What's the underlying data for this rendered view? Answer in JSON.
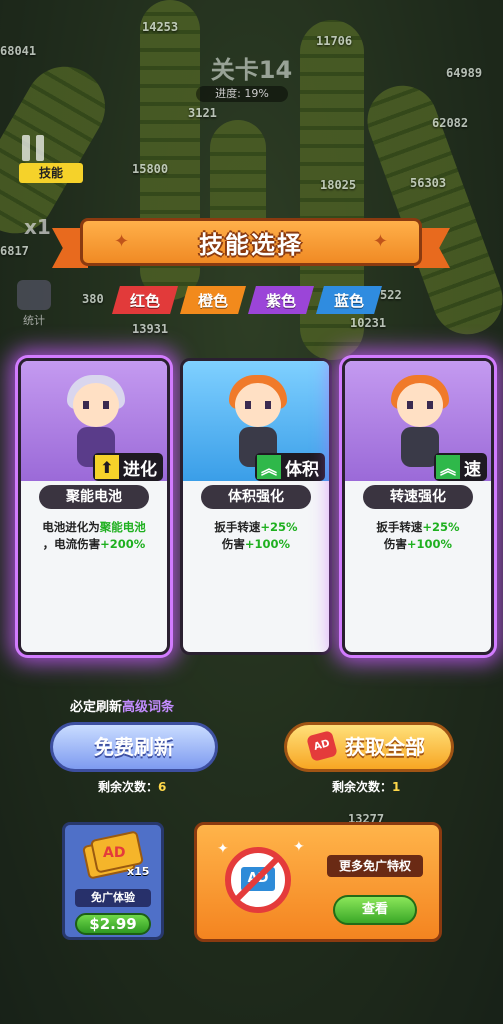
{
  "background": {
    "stage_title": "关卡14",
    "progress_text": "进度: 19%",
    "skill_tag": "技能",
    "speed_label": "x1",
    "stats_label": "统计",
    "numbers": [
      "68041",
      "14253",
      "11706",
      "64989",
      "62082",
      "15800",
      "18025",
      "56303",
      "6817",
      "3121",
      "13931",
      "10231",
      "13277",
      "380",
      "522"
    ]
  },
  "header": {
    "title": "技能选择"
  },
  "color_filters": [
    {
      "label": "红色",
      "color": "#e23a3a"
    },
    {
      "label": "橙色",
      "color": "#f28a1c"
    },
    {
      "label": "紫色",
      "color": "#9b45d8"
    },
    {
      "label": "蓝色",
      "color": "#2f8ce0"
    }
  ],
  "cards": [
    {
      "name": "聚能电池",
      "badge": "进化",
      "badge_icon": "arrow-up-icon",
      "desc_line1_pre": "电池进化为",
      "desc_line1_hl": "聚能电池",
      "desc_line2_pre": "，电流伤害",
      "desc_line2_hl": "+200%",
      "theme": "#c79cf2"
    },
    {
      "name": "体积强化",
      "badge": "体积",
      "badge_icon": "double-chevron-up-icon",
      "desc_line1_pre": "扳手转速",
      "desc_line1_hl": "+25%",
      "desc_line2_pre": "伤害",
      "desc_line2_hl": "+100%",
      "theme": "#5bb7ff"
    },
    {
      "name": "转速强化",
      "badge": "速",
      "badge_icon": "double-chevron-up-icon",
      "desc_line1_pre": "扳手转速",
      "desc_line1_hl": "+25%",
      "desc_line2_pre": "伤害",
      "desc_line2_hl": "+100%",
      "theme": "#c79cf2"
    }
  ],
  "refresh_note_pre": "必定刷新",
  "refresh_note_hl": "高级词条",
  "buttons": {
    "free_refresh": "免费刷新",
    "get_all": "获取全部",
    "ad_icon_text": "AD"
  },
  "remaining": {
    "label": "剩余次数：",
    "free_refresh_count": "6",
    "get_all_count": "1"
  },
  "ad_pack": {
    "ad_text": "AD",
    "multiplier": "x15",
    "trial_label": "免广体验",
    "price": "$2.99"
  },
  "privilege": {
    "icon_text": "AD",
    "title": "更多免广特权",
    "view_button": "查看"
  }
}
